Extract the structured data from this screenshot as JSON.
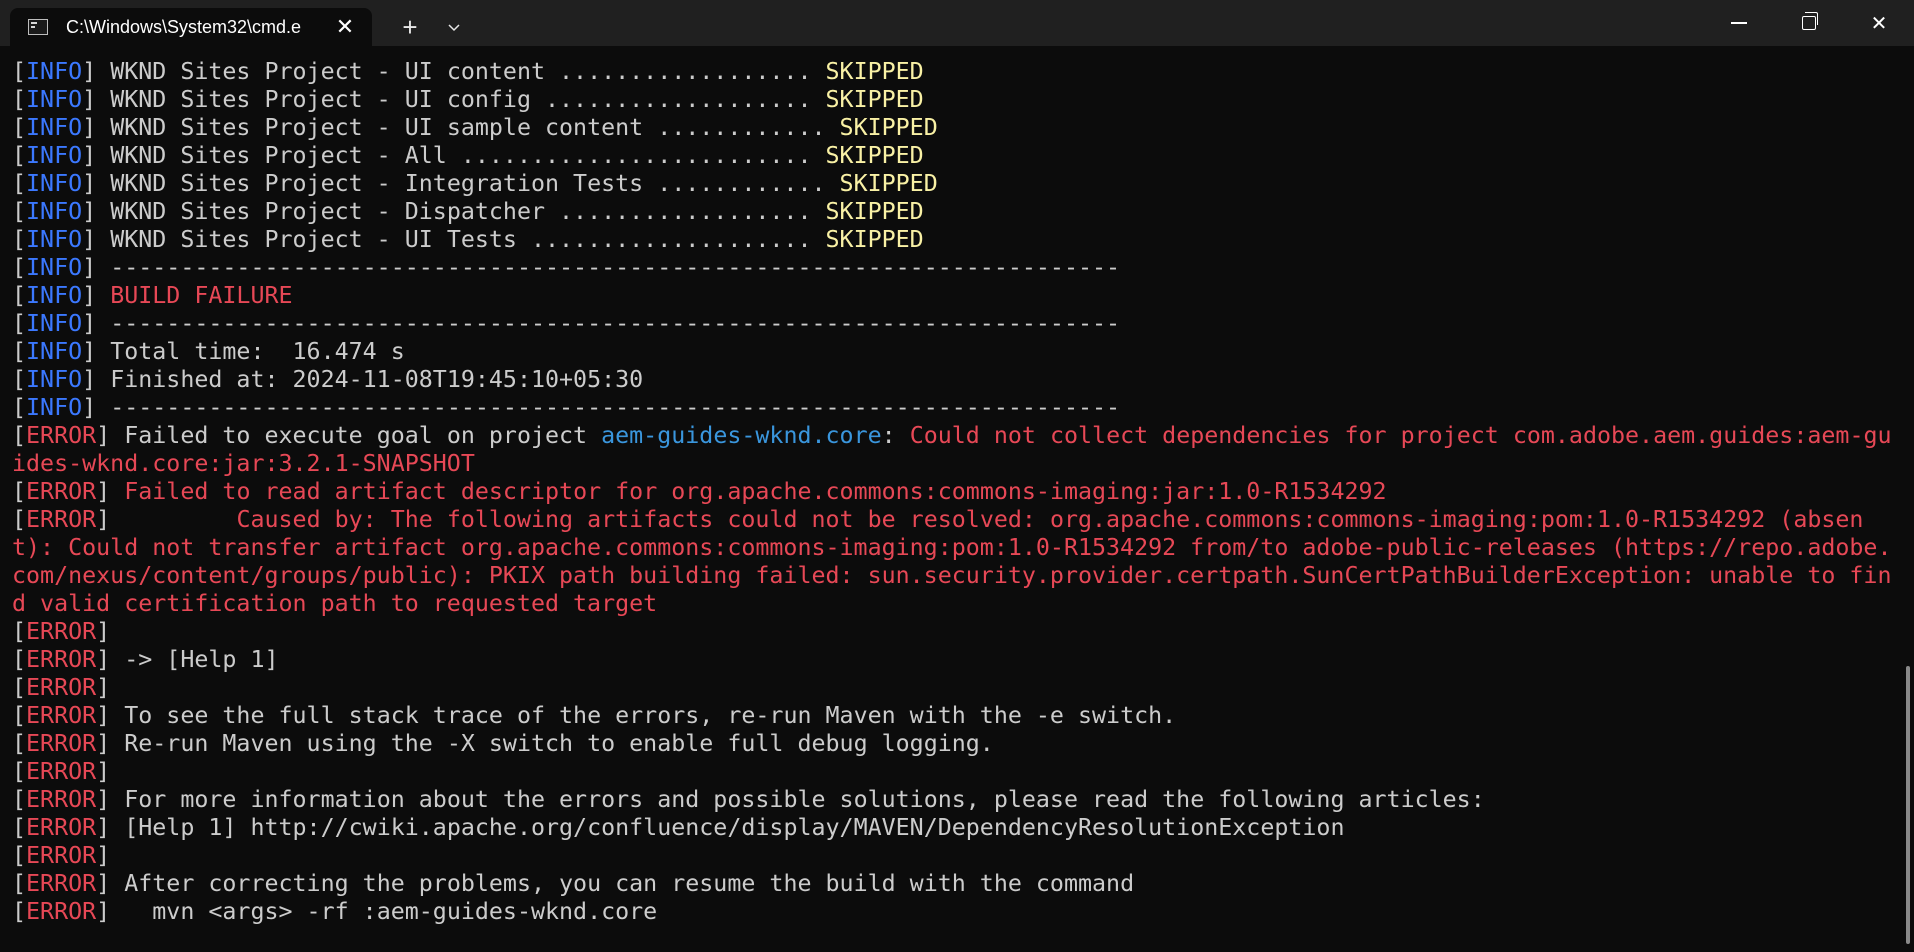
{
  "window": {
    "tab_title": "C:\\Windows\\System32\\cmd.e",
    "tab_close": "✕",
    "new_tab": "+",
    "dropdown": "⌄",
    "close": "✕"
  },
  "colors": {
    "background": "#0c0c0c",
    "titlebar": "#202020",
    "default_text": "#cccccc",
    "info": "#3b78ff",
    "skipped": "#f9f1a5",
    "error": "#e74856",
    "link": "#3a96dd"
  },
  "console": {
    "lines": [
      [
        {
          "t": "[",
          "c": "default"
        },
        {
          "t": "INFO",
          "c": "info"
        },
        {
          "t": "] WKND Sites Project - UI content .................. ",
          "c": "default"
        },
        {
          "t": "SKIPPED",
          "c": "yellow"
        }
      ],
      [
        {
          "t": "[",
          "c": "default"
        },
        {
          "t": "INFO",
          "c": "info"
        },
        {
          "t": "] WKND Sites Project - UI config ................... ",
          "c": "default"
        },
        {
          "t": "SKIPPED",
          "c": "yellow"
        }
      ],
      [
        {
          "t": "[",
          "c": "default"
        },
        {
          "t": "INFO",
          "c": "info"
        },
        {
          "t": "] WKND Sites Project - UI sample content ............ ",
          "c": "default"
        },
        {
          "t": "SKIPPED",
          "c": "yellow"
        }
      ],
      [
        {
          "t": "[",
          "c": "default"
        },
        {
          "t": "INFO",
          "c": "info"
        },
        {
          "t": "] WKND Sites Project - All ......................... ",
          "c": "default"
        },
        {
          "t": "SKIPPED",
          "c": "yellow"
        }
      ],
      [
        {
          "t": "[",
          "c": "default"
        },
        {
          "t": "INFO",
          "c": "info"
        },
        {
          "t": "] WKND Sites Project - Integration Tests ............ ",
          "c": "default"
        },
        {
          "t": "SKIPPED",
          "c": "yellow"
        }
      ],
      [
        {
          "t": "[",
          "c": "default"
        },
        {
          "t": "INFO",
          "c": "info"
        },
        {
          "t": "] WKND Sites Project - Dispatcher .................. ",
          "c": "default"
        },
        {
          "t": "SKIPPED",
          "c": "yellow"
        }
      ],
      [
        {
          "t": "[",
          "c": "default"
        },
        {
          "t": "INFO",
          "c": "info"
        },
        {
          "t": "] WKND Sites Project - UI Tests .................... ",
          "c": "default"
        },
        {
          "t": "SKIPPED",
          "c": "yellow"
        }
      ],
      [
        {
          "t": "[",
          "c": "default"
        },
        {
          "t": "INFO",
          "c": "info"
        },
        {
          "t": "] ------------------------------------------------------------------------",
          "c": "default"
        }
      ],
      [
        {
          "t": "[",
          "c": "default"
        },
        {
          "t": "INFO",
          "c": "info"
        },
        {
          "t": "] ",
          "c": "default"
        },
        {
          "t": "BUILD FAILURE",
          "c": "red"
        }
      ],
      [
        {
          "t": "[",
          "c": "default"
        },
        {
          "t": "INFO",
          "c": "info"
        },
        {
          "t": "] ------------------------------------------------------------------------",
          "c": "default"
        }
      ],
      [
        {
          "t": "[",
          "c": "default"
        },
        {
          "t": "INFO",
          "c": "info"
        },
        {
          "t": "] Total time:  16.474 s",
          "c": "default"
        }
      ],
      [
        {
          "t": "[",
          "c": "default"
        },
        {
          "t": "INFO",
          "c": "info"
        },
        {
          "t": "] Finished at: 2024-11-08T19:45:10+05:30",
          "c": "default"
        }
      ],
      [
        {
          "t": "[",
          "c": "default"
        },
        {
          "t": "INFO",
          "c": "info"
        },
        {
          "t": "] ------------------------------------------------------------------------",
          "c": "default"
        }
      ],
      [
        {
          "t": "[",
          "c": "default"
        },
        {
          "t": "ERROR",
          "c": "red"
        },
        {
          "t": "] Failed to execute goal on project ",
          "c": "default"
        },
        {
          "t": "aem-guides-wknd.core",
          "c": "blue"
        },
        {
          "t": ": ",
          "c": "default"
        },
        {
          "t": "Could not collect dependencies for project com.adobe.aem.guides:aem-guides-wknd.core:jar:3.2.1-SNAPSHOT",
          "c": "red"
        }
      ],
      [
        {
          "t": "[",
          "c": "default"
        },
        {
          "t": "ERROR",
          "c": "red"
        },
        {
          "t": "] ",
          "c": "default"
        },
        {
          "t": "Failed to read artifact descriptor for org.apache.commons:commons-imaging:jar:1.0-R1534292",
          "c": "red"
        }
      ],
      [
        {
          "t": "[",
          "c": "default"
        },
        {
          "t": "ERROR",
          "c": "red"
        },
        {
          "t": "] ",
          "c": "default"
        },
        {
          "t": "        Caused by: The following artifacts could not be resolved: org.apache.commons:commons-imaging:pom:1.0-R1534292 (absent): Could not transfer artifact org.apache.commons:commons-imaging:pom:1.0-R1534292 from/to adobe-public-releases (https://repo.adobe.com/nexus/content/groups/public): PKIX path building failed: sun.security.provider.certpath.SunCertPathBuilderException: unable to find valid certification path to requested target",
          "c": "red"
        }
      ],
      [
        {
          "t": "[",
          "c": "default"
        },
        {
          "t": "ERROR",
          "c": "red"
        },
        {
          "t": "]",
          "c": "default"
        }
      ],
      [
        {
          "t": "[",
          "c": "default"
        },
        {
          "t": "ERROR",
          "c": "red"
        },
        {
          "t": "] -> [Help 1]",
          "c": "default"
        }
      ],
      [
        {
          "t": "[",
          "c": "default"
        },
        {
          "t": "ERROR",
          "c": "red"
        },
        {
          "t": "]",
          "c": "default"
        }
      ],
      [
        {
          "t": "[",
          "c": "default"
        },
        {
          "t": "ERROR",
          "c": "red"
        },
        {
          "t": "] To see the full stack trace of the errors, re-run Maven with the -e switch.",
          "c": "default"
        }
      ],
      [
        {
          "t": "[",
          "c": "default"
        },
        {
          "t": "ERROR",
          "c": "red"
        },
        {
          "t": "] Re-run Maven using the -X switch to enable full debug logging.",
          "c": "default"
        }
      ],
      [
        {
          "t": "[",
          "c": "default"
        },
        {
          "t": "ERROR",
          "c": "red"
        },
        {
          "t": "]",
          "c": "default"
        }
      ],
      [
        {
          "t": "[",
          "c": "default"
        },
        {
          "t": "ERROR",
          "c": "red"
        },
        {
          "t": "] For more information about the errors and possible solutions, please read the following articles:",
          "c": "default"
        }
      ],
      [
        {
          "t": "[",
          "c": "default"
        },
        {
          "t": "ERROR",
          "c": "red"
        },
        {
          "t": "] [Help 1] http://cwiki.apache.org/confluence/display/MAVEN/DependencyResolutionException",
          "c": "default"
        }
      ],
      [
        {
          "t": "[",
          "c": "default"
        },
        {
          "t": "ERROR",
          "c": "red"
        },
        {
          "t": "]",
          "c": "default"
        }
      ],
      [
        {
          "t": "[",
          "c": "default"
        },
        {
          "t": "ERROR",
          "c": "red"
        },
        {
          "t": "] After correcting the problems, you can resume the build with the command",
          "c": "default"
        }
      ],
      [
        {
          "t": "[",
          "c": "default"
        },
        {
          "t": "ERROR",
          "c": "red"
        },
        {
          "t": "]   mvn <args> -rf :aem-guides-wknd.core",
          "c": "default"
        }
      ]
    ]
  }
}
